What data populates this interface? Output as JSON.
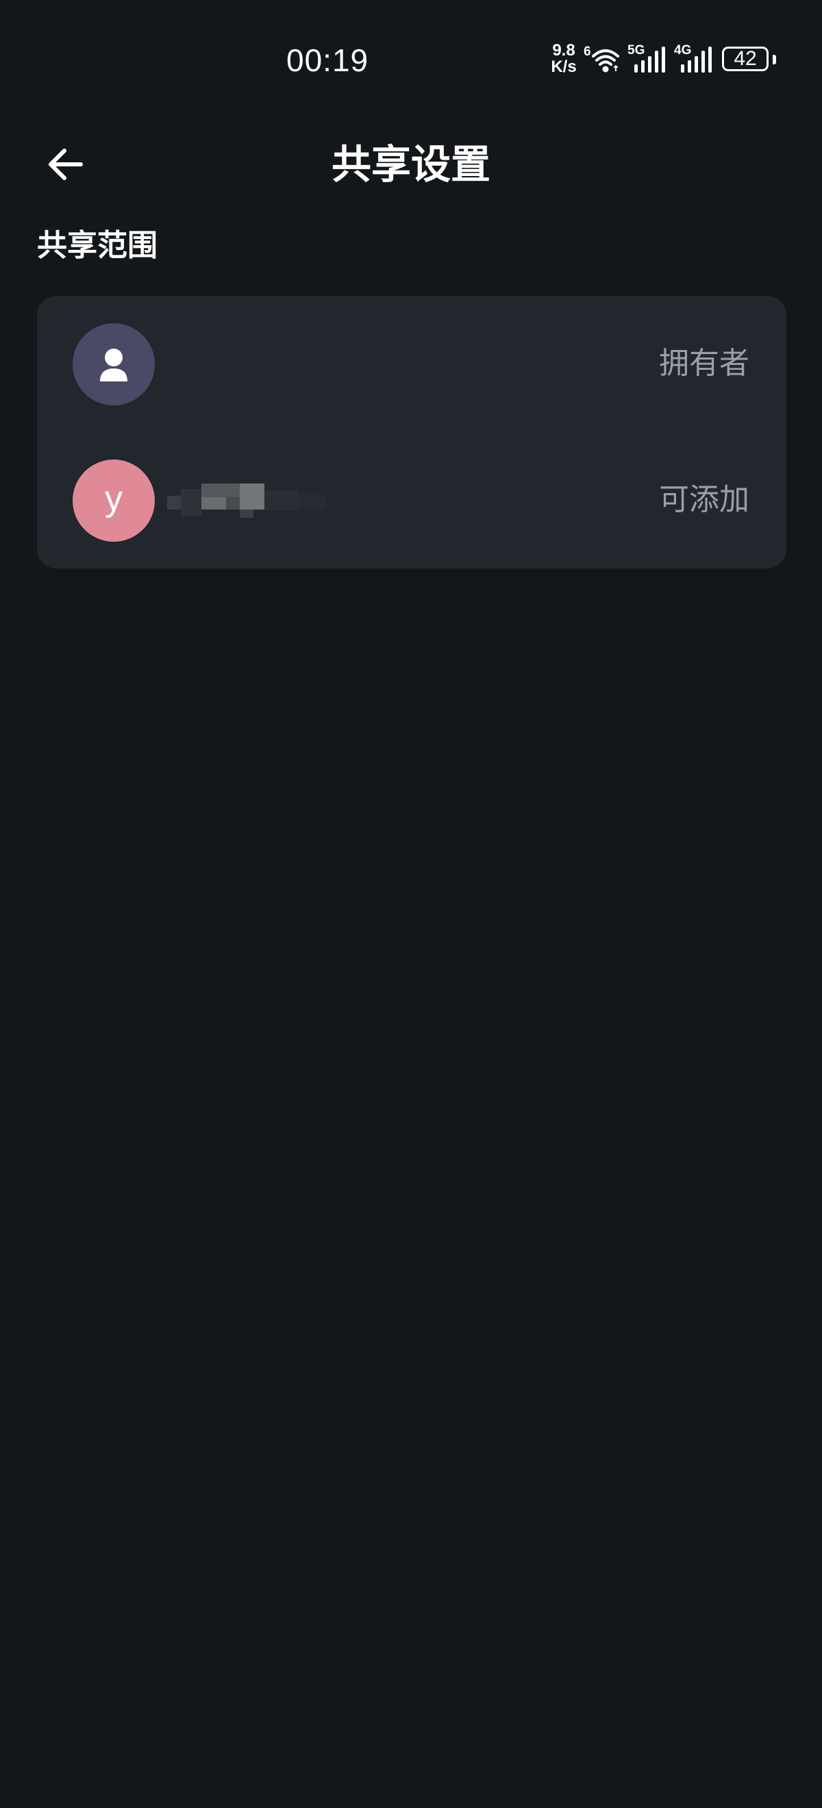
{
  "status_bar": {
    "time": "00:19",
    "net_speed_value": "9.8",
    "net_speed_unit": "K/s",
    "wifi_label": "6",
    "signal_1_label": "5G",
    "signal_2_label": "4G",
    "battery_level": "42"
  },
  "header": {
    "title": "共享设置",
    "back_icon": "arrow-left-icon"
  },
  "section": {
    "label": "共享范围"
  },
  "members": [
    {
      "avatar_icon": "person-icon",
      "avatar_color": "#4a4a66",
      "name": "",
      "role": "拥有者"
    },
    {
      "avatar_letter": "y",
      "avatar_color": "#e08a98",
      "role": "可添加"
    }
  ],
  "colors": {
    "background": "#14171a",
    "card": "#22262d",
    "role_text": "#9aa0a8"
  }
}
